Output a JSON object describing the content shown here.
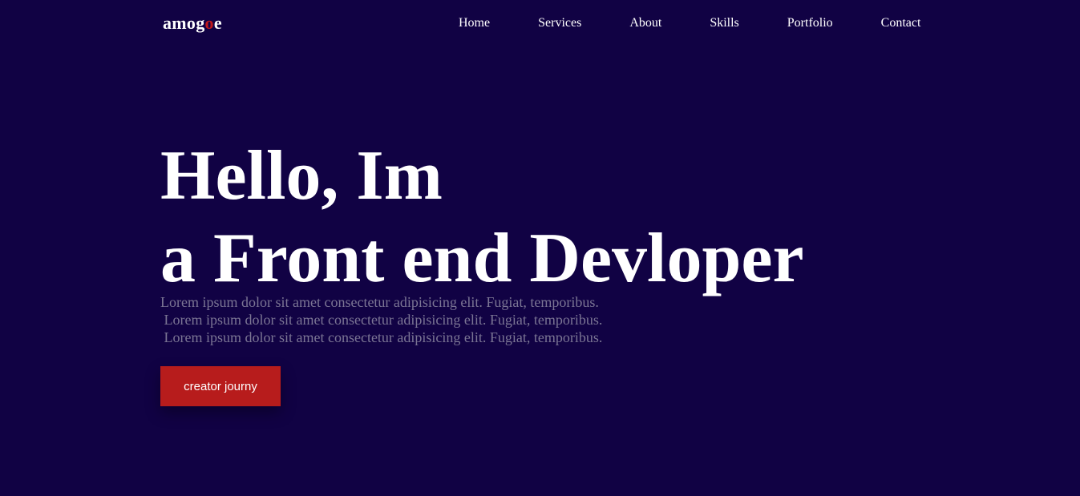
{
  "logo": {
    "part1": "amog",
    "accent": "o",
    "part2": "e",
    "accent_color": "#c0181b"
  },
  "nav": {
    "items": [
      "Home",
      "Services",
      "About",
      "Skills",
      "Portfolio",
      "Contact"
    ]
  },
  "hero": {
    "line1": "Hello, Im",
    "line2": "a Front end Devloper",
    "description": [
      "Lorem ipsum dolor sit amet consectetur adipisicing elit. Fugiat, temporibus.",
      " Lorem ipsum dolor sit amet consectetur adipisicing elit. Fugiat, temporibus.",
      " Lorem ipsum dolor sit amet consectetur adipisicing elit. Fugiat, temporibus."
    ],
    "cta_label": "creator journy"
  },
  "colors": {
    "background": "#110244",
    "button": "#b71c1c",
    "text": "#ffffff",
    "muted": "#7b7594"
  }
}
